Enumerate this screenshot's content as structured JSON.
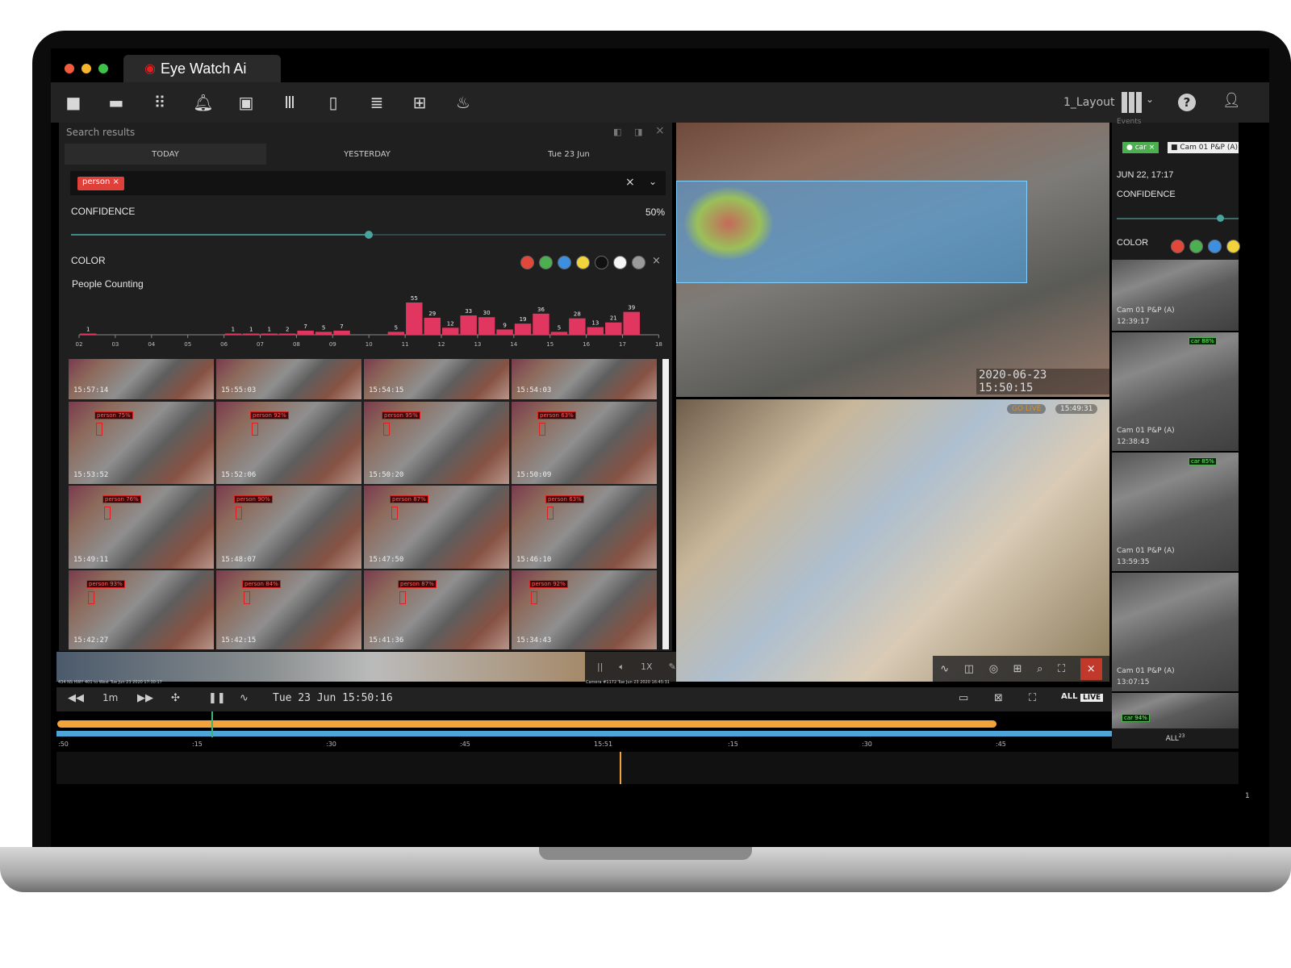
{
  "app": {
    "title": "Eye Watch Ai",
    "logo_icon": "eye-icon"
  },
  "toolbar": {
    "icons": [
      "camera-icon",
      "folder-icon",
      "grid-icon",
      "bell-icon",
      "calendar-icon",
      "library-icon",
      "map-icon",
      "list-icon",
      "layout-tiles-icon",
      "fire-icon"
    ],
    "layout_label": "1_Layout",
    "help_icon": "help-icon",
    "user_icon": "user-icon"
  },
  "search": {
    "title": "Search results",
    "tabs": [
      "TODAY",
      "YESTERDAY",
      "Tue 23 Jun"
    ],
    "filter_tag": "person",
    "confidence_label": "CONFIDENCE",
    "confidence_value": "50%",
    "confidence": 0.5,
    "color_label": "COLOR",
    "colors": [
      "#e2473a",
      "#4caf50",
      "#3d8fe0",
      "#f1d43c",
      "#111111",
      "#f5f5f5",
      "#9a9a9a"
    ],
    "chart_title": "People Counting",
    "thumbnails": [
      {
        "time": "15:57:14",
        "tag": ""
      },
      {
        "time": "15:55:03",
        "tag": ""
      },
      {
        "time": "15:54:15",
        "tag": ""
      },
      {
        "time": "15:54:03",
        "tag": ""
      },
      {
        "time": "15:53:52",
        "tag": "person 75%"
      },
      {
        "time": "15:52:06",
        "tag": "person 92%"
      },
      {
        "time": "15:50:20",
        "tag": "person 95%"
      },
      {
        "time": "15:50:09",
        "tag": "person 63%"
      },
      {
        "time": "15:49:11",
        "tag": "person 76%"
      },
      {
        "time": "15:48:07",
        "tag": "person 90%"
      },
      {
        "time": "15:47:50",
        "tag": "person 87%"
      },
      {
        "time": "15:46:10",
        "tag": "person 63%"
      },
      {
        "time": "15:42:27",
        "tag": "person 93%"
      },
      {
        "time": "15:42:15",
        "tag": "person 84%"
      },
      {
        "time": "15:41:36",
        "tag": "person 87%"
      },
      {
        "time": "15:34:43",
        "tag": "person 92%"
      }
    ]
  },
  "chart_data": {
    "type": "bar",
    "title": "People Counting",
    "tick_labels": [
      "02",
      "03",
      "04",
      "05",
      "06",
      "07",
      "08",
      "09",
      "10",
      "11",
      "12",
      "13",
      "14",
      "15",
      "16",
      "17",
      "18"
    ],
    "xlim": [
      "02:00",
      "18:00"
    ],
    "bins": [
      {
        "start": "02:00",
        "value": 1
      },
      {
        "start": "06:00",
        "value": 1
      },
      {
        "start": "06:30",
        "value": 1
      },
      {
        "start": "07:00",
        "value": 1
      },
      {
        "start": "07:30",
        "value": 2
      },
      {
        "start": "08:00",
        "value": 7
      },
      {
        "start": "08:30",
        "value": 5
      },
      {
        "start": "09:00",
        "value": 7
      },
      {
        "start": "10:30",
        "value": 5
      },
      {
        "start": "11:00",
        "value": 55
      },
      {
        "start": "11:30",
        "value": 29
      },
      {
        "start": "12:00",
        "value": 12
      },
      {
        "start": "12:30",
        "value": 33
      },
      {
        "start": "13:00",
        "value": 30
      },
      {
        "start": "13:30",
        "value": 9
      },
      {
        "start": "14:00",
        "value": 19
      },
      {
        "start": "14:30",
        "value": 36
      },
      {
        "start": "15:00",
        "value": 5
      },
      {
        "start": "15:30",
        "value": 28
      },
      {
        "start": "16:00",
        "value": 13
      },
      {
        "start": "16:30",
        "value": 21
      },
      {
        "start": "17:00",
        "value": 39
      }
    ],
    "color": "#e0365f"
  },
  "videos": {
    "top_timestamp": "2020-06-23 15:50:15",
    "bottom_live": "GO LIVE",
    "bottom_time": "15:49:31",
    "bottom_controls": [
      "activity-icon",
      "columns-icon",
      "snapshot-icon",
      "grid-icon",
      "zoom-icon",
      "fullscreen-icon",
      "close-icon"
    ],
    "left_caption": "434 NS HWY 401 to West Tue Jun 23 2020 17:30:17",
    "mid_caption": "Camera #1172 Tue Jun 23 2020 16:45:31",
    "mini_controls": [
      "||",
      "speaker",
      "1X",
      "edit"
    ]
  },
  "events": {
    "title": "Events",
    "filter_tag": "car",
    "camera_tag": "Cam 01 P&P (A)",
    "date": "JUN 22, 17:17",
    "confidence_label": "CONFIDENCE",
    "confidence": 0.85,
    "color_label": "COLOR",
    "colors": [
      "#e2473a",
      "#4caf50",
      "#3d8fe0",
      "#f1d43c"
    ],
    "items": [
      {
        "camera": "Cam 01 P&P (A)",
        "time": "12:39:17",
        "tag": ""
      },
      {
        "camera": "Cam 01 P&P (A)",
        "time": "12:38:43",
        "tag": "car 88%"
      },
      {
        "camera": "Cam 01 P&P (A)",
        "time": "13:59:35",
        "tag": "car 85%"
      },
      {
        "camera": "Cam 01 P&P (A)",
        "time": "13:07:15",
        "tag": ""
      },
      {
        "camera": "",
        "time": "",
        "tag": "car 94%"
      }
    ],
    "all_label": "ALL",
    "all_count": "23"
  },
  "playback": {
    "step": "1m",
    "datetime": "Tue 23 Jun 15:50:16",
    "all_label": "ALL",
    "live_label": "LIVE",
    "ticks": [
      ":50",
      ":15",
      ":30",
      ":45",
      "15:51",
      ":15",
      ":30",
      ":45"
    ],
    "progress": 0.89,
    "cursor": 0.147,
    "page": "1"
  }
}
